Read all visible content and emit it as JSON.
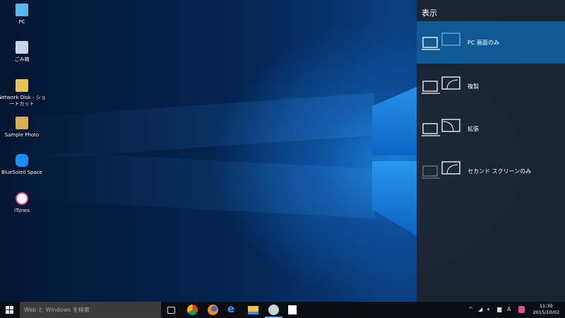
{
  "desktop": {
    "icons": [
      {
        "label": "PC"
      },
      {
        "label": "ごみ箱"
      },
      {
        "label": "Network Disk - ショートカット"
      },
      {
        "label": "Sample Photo"
      },
      {
        "label": "BlueSoleil Space"
      },
      {
        "label": "iTunes"
      }
    ]
  },
  "project_panel": {
    "title": "表示",
    "options": [
      {
        "label": "PC 画面のみ",
        "selected": true
      },
      {
        "label": "複製"
      },
      {
        "label": "拡張"
      },
      {
        "label": "セカンド スクリーンのみ"
      }
    ]
  },
  "taskbar": {
    "search_placeholder": "Web と Windows を検索",
    "apps": [
      "task-view",
      "chrome",
      "firefox",
      "edge",
      "file-explorer",
      "paint-app",
      "store"
    ],
    "time": "11:30",
    "date": "2015/10/02",
    "ime": "A",
    "accent": "#0e5a97"
  }
}
